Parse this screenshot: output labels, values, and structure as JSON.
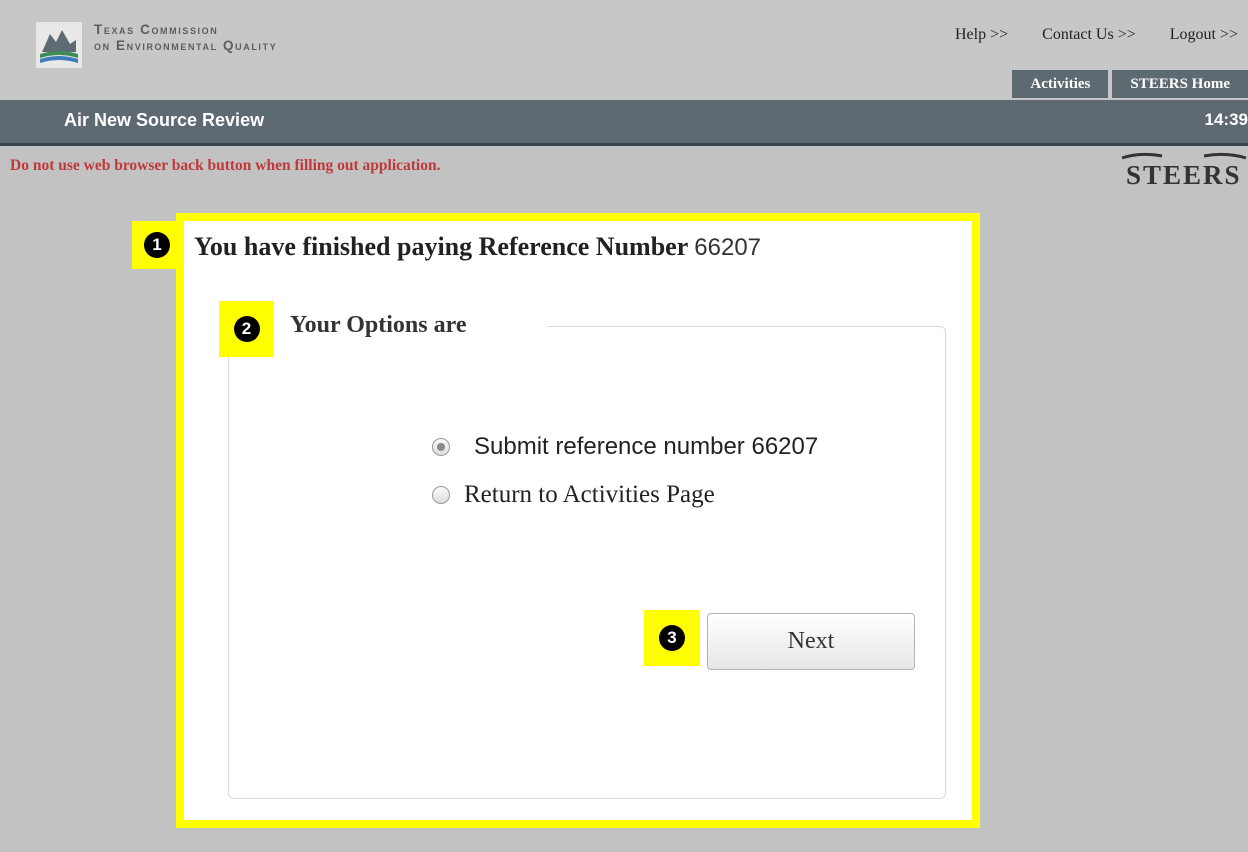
{
  "header": {
    "org_line1": "Texas Commission",
    "org_line2": "on Environmental Quality",
    "links": {
      "help": "Help >>",
      "contact": "Contact Us >>",
      "logout": "Logout >>"
    },
    "tabs": {
      "activities": "Activities",
      "steers_home": "STEERS Home"
    }
  },
  "titlebar": {
    "title": "Air New Source Review",
    "clock": "14:39"
  },
  "warning": "Do not use web browser back button when filling out application.",
  "brand": "STEERS",
  "main": {
    "heading": "You have finished paying Reference Number",
    "reference_number": "66207",
    "options_legend": "Your Options are",
    "option_submit": "Submit reference number 66207",
    "option_return": "Return to Activities Page",
    "next_label": "Next"
  },
  "markers": [
    "1",
    "2",
    "3"
  ],
  "colors": {
    "highlight": "#ffff00",
    "nav_bar": "#5e6a71",
    "warning": "#c0383a",
    "background": "#c2c2c2"
  }
}
